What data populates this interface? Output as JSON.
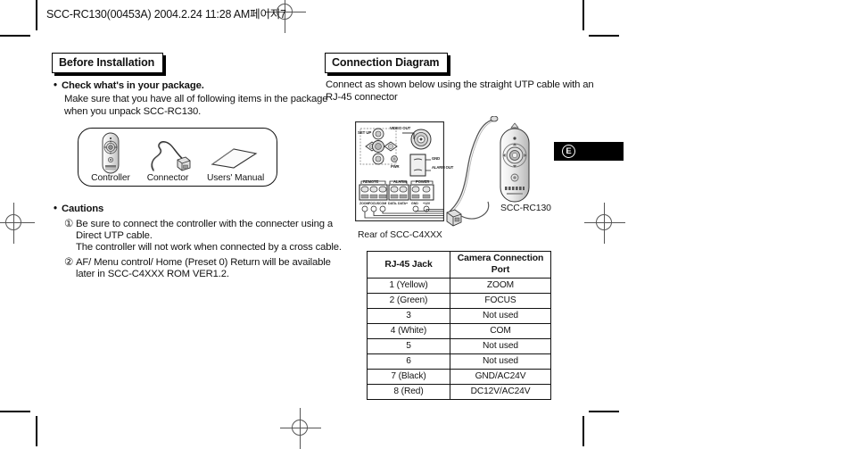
{
  "sheet": {
    "header_line": "SCC-RC130(00453A)  2004.2.24 11:28 AM페이지7",
    "language_badge": "E"
  },
  "left_column": {
    "section_title": "Before Installation",
    "check_heading": "Check what's in your package.",
    "check_body_line1": "Make sure that you have all of following items in the package",
    "check_body_line2": "when you unpack SCC-RC130.",
    "package_items": [
      {
        "label": "Controller",
        "icon": "remote-controller-icon"
      },
      {
        "label": "Connector",
        "icon": "cable-connector-icon"
      },
      {
        "label": "Users' Manual",
        "icon": "manual-booklet-icon"
      }
    ],
    "cautions_heading": "Cautions",
    "cautions": [
      {
        "marker": "①",
        "lines": [
          "Be sure to connect the controller with the connecter using a",
          "Direct UTP cable.",
          "The controller will not work when connected by a cross cable."
        ]
      },
      {
        "marker": "②",
        "lines": [
          "AF/ Menu control/ Home (Preset 0) Return will be available",
          "later in SCC-C4XXX ROM VER1.2."
        ]
      }
    ]
  },
  "right_column": {
    "section_title": "Connection Diagram",
    "intro_line1": "Connect as shown below using the straight UTP cable with an",
    "intro_line2": "RJ-45 connector",
    "rear_panel_caption": "Rear of SCC-C4XXX",
    "controller_caption": "SCC-RC130",
    "rear_panel_labels": {
      "setup": "SET UP",
      "video_out": "VIDEO OUT",
      "pwr": "PWR",
      "gnd_terminal": "GND",
      "alarm_out_terminal": "ALARM OUT",
      "block_remote": "REMOTE",
      "block_alarm": "ALARM",
      "block_power": "POWER",
      "pins": [
        "ZOOM",
        "FOCUS",
        "COM",
        "DATA-",
        "DATA+",
        "GND",
        "+12V"
      ],
      "pin_numbers": [
        "①",
        "②",
        "③",
        "⑥",
        "⑦"
      ]
    },
    "table": {
      "headers": [
        "RJ-45 Jack",
        "Camera Connection Port"
      ],
      "rows": [
        [
          "1 (Yellow)",
          "ZOOM"
        ],
        [
          "2 (Green)",
          "FOCUS"
        ],
        [
          "3",
          "Not used"
        ],
        [
          "4 (White)",
          "COM"
        ],
        [
          "5",
          "Not used"
        ],
        [
          "6",
          "Not used"
        ],
        [
          "7 (Black)",
          "GND/AC24V"
        ],
        [
          "8 (Red)",
          "DC12V/AC24V"
        ]
      ]
    }
  }
}
